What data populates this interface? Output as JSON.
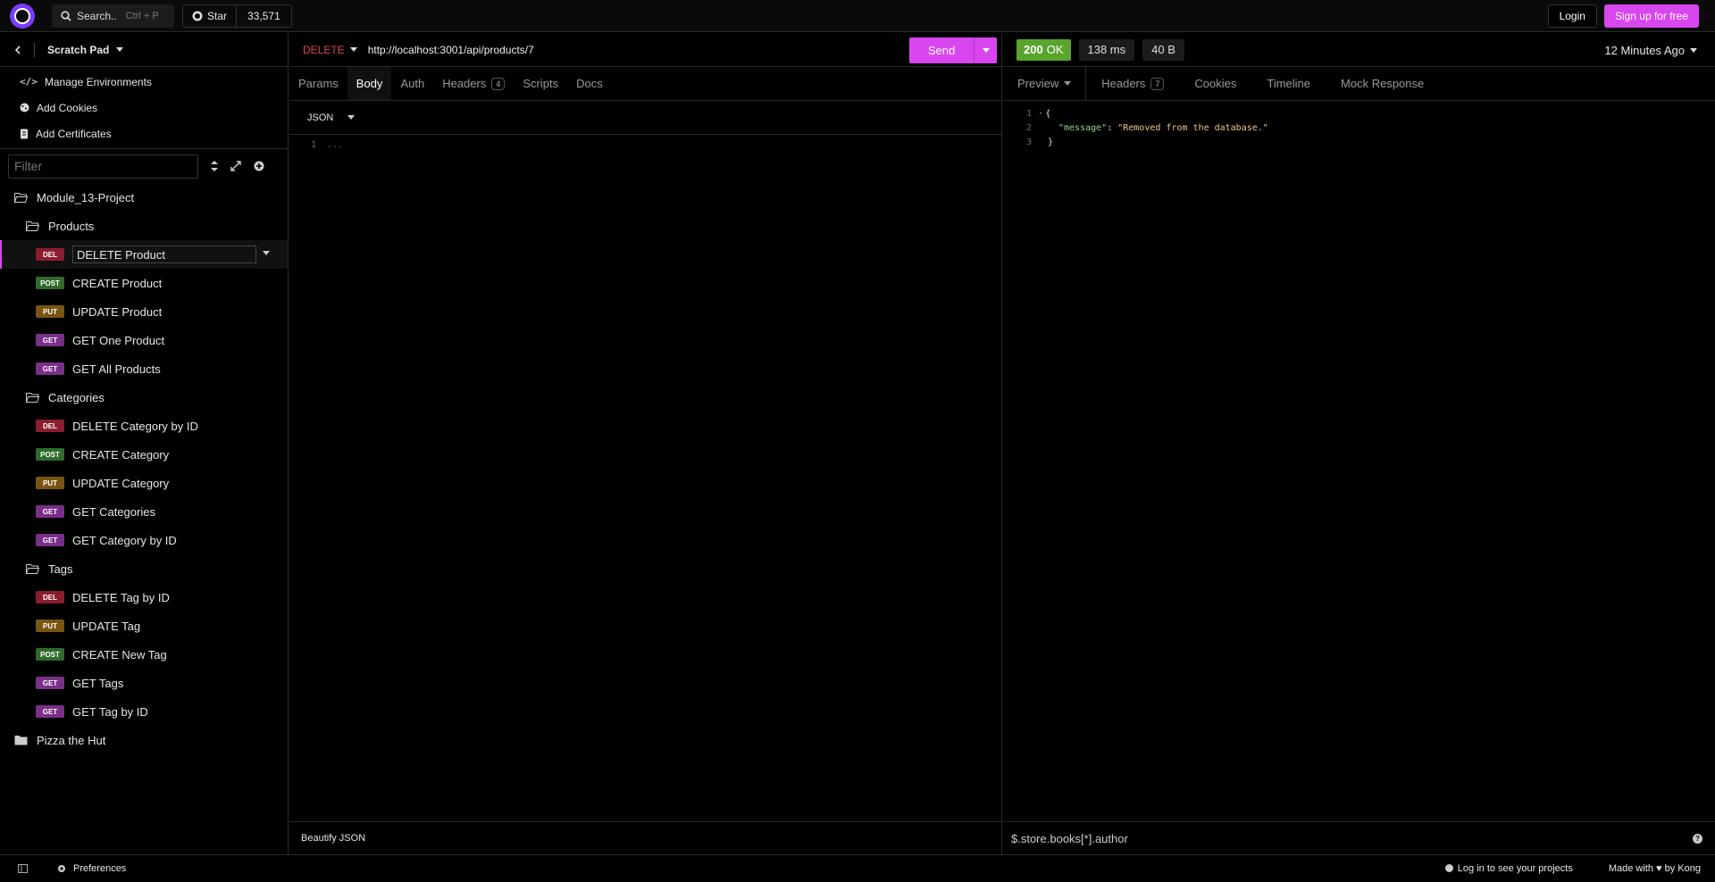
{
  "topbar": {
    "search_label": "Search..",
    "search_shortcut": "Ctrl + P",
    "star_label": "Star",
    "star_count": "33,571",
    "login_label": "Login",
    "signup_label": "Sign up for free"
  },
  "sidebar": {
    "title": "Scratch Pad",
    "links": [
      {
        "label": "Manage Environments",
        "icon": "code-icon"
      },
      {
        "label": "Add Cookies",
        "icon": "cookie-icon"
      },
      {
        "label": "Add Certificates",
        "icon": "certificate-icon"
      }
    ],
    "filter_placeholder": "Filter",
    "tree": {
      "project": "Module_13-Project",
      "folders": [
        {
          "name": "Products",
          "items": [
            {
              "method": "DEL",
              "name": "DELETE Product"
            },
            {
              "method": "POST",
              "name": "CREATE Product"
            },
            {
              "method": "PUT",
              "name": "UPDATE Product"
            },
            {
              "method": "GET",
              "name": "GET One Product"
            },
            {
              "method": "GET",
              "name": "GET All Products"
            }
          ]
        },
        {
          "name": "Categories",
          "items": [
            {
              "method": "DEL",
              "name": "DELETE Category by ID"
            },
            {
              "method": "POST",
              "name": "CREATE Category"
            },
            {
              "method": "PUT",
              "name": "UPDATE Category"
            },
            {
              "method": "GET",
              "name": "GET Categories"
            },
            {
              "method": "GET",
              "name": "GET Category by ID"
            }
          ]
        },
        {
          "name": "Tags",
          "items": [
            {
              "method": "DEL",
              "name": "DELETE Tag by ID"
            },
            {
              "method": "PUT",
              "name": "UPDATE Tag"
            },
            {
              "method": "POST",
              "name": "CREATE New Tag"
            },
            {
              "method": "GET",
              "name": "GET Tags"
            },
            {
              "method": "GET",
              "name": "GET Tag by ID"
            }
          ]
        }
      ],
      "other_project": "Pizza the Hut"
    }
  },
  "request": {
    "method": "DELETE",
    "url": "http://localhost:3001/api/products/7",
    "send_label": "Send",
    "tabs": {
      "params": "Params",
      "body": "Body",
      "auth": "Auth",
      "headers": "Headers",
      "headers_count": "4",
      "scripts": "Scripts",
      "docs": "Docs"
    },
    "body_type": "JSON",
    "editor_line": "1",
    "editor_placeholder": "...",
    "footer": "Beautify JSON"
  },
  "response": {
    "status_code": "200",
    "status_text": "OK",
    "time": "138 ms",
    "size": "40 B",
    "time_ago": "12 Minutes Ago",
    "tabs": {
      "preview": "Preview",
      "headers": "Headers",
      "headers_count": "7",
      "cookies": "Cookies",
      "timeline": "Timeline",
      "mock": "Mock Response"
    },
    "lines": [
      "1",
      "2",
      "3"
    ],
    "open_brace": "{",
    "key": "\"message\"",
    "colon": ": ",
    "value": "\"Removed from the database.\"",
    "close_brace": "}",
    "filter_query": "$.store.books[*].author",
    "help": "?"
  },
  "statusbar": {
    "preferences": "Preferences",
    "login_hint": "Log in to see your projects",
    "made_with": "Made with",
    "by": "by Kong"
  },
  "colors": {
    "accent": "#d946ef",
    "ok": "#59a52c",
    "delete": "#e0445a"
  }
}
